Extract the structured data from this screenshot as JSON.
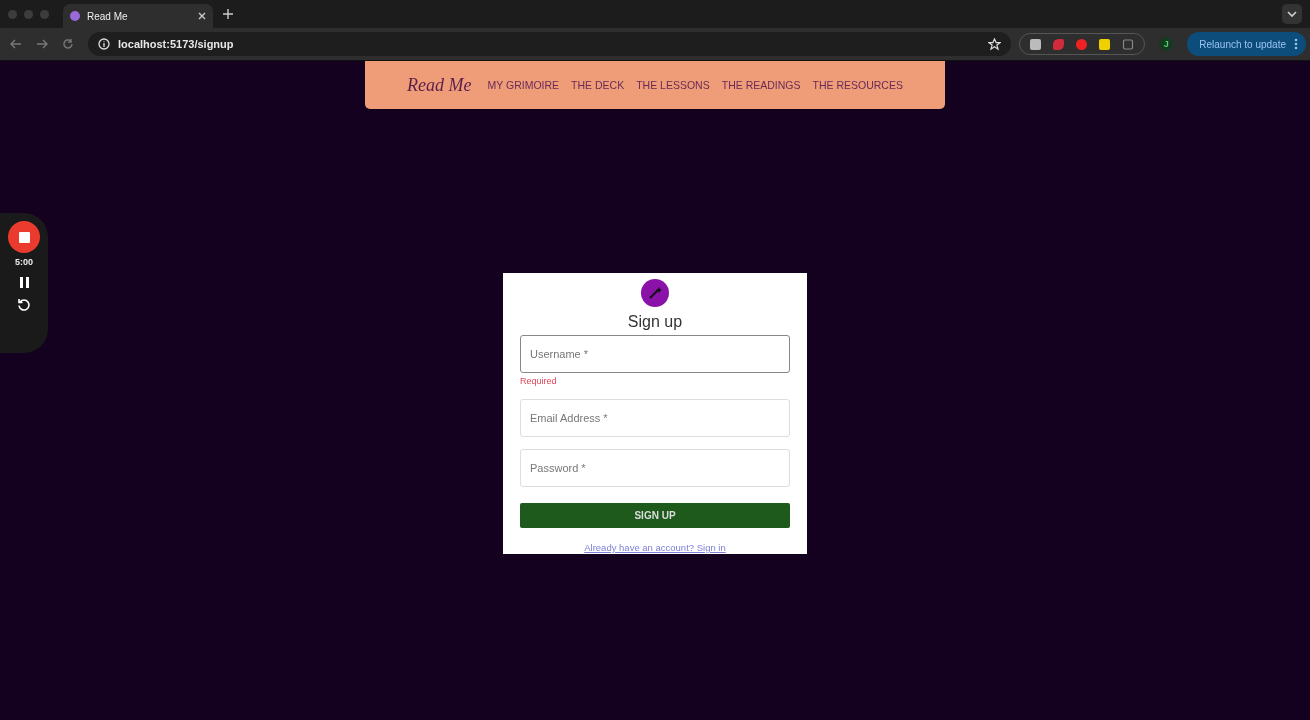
{
  "browser": {
    "tabs": [
      {
        "title": "Read Me",
        "selected": true
      }
    ],
    "address": "localhost:5173/signup",
    "relaunch": "Relaunch to update",
    "profile": "J"
  },
  "recorder": {
    "time": "5:00"
  },
  "nav": {
    "brand": "Read Me",
    "links": [
      "MY GRIMOIRE",
      "THE DECK",
      "THE LESSONS",
      "THE READINGS",
      "THE RESOURCES"
    ]
  },
  "form": {
    "title": "Sign up",
    "fields": [
      {
        "placeholder": "Username *",
        "error": "Required"
      },
      {
        "placeholder": "Email Address *"
      },
      {
        "placeholder": "Password *"
      }
    ],
    "submit": "SIGN UP",
    "link": "Already have an account? Sign in"
  }
}
